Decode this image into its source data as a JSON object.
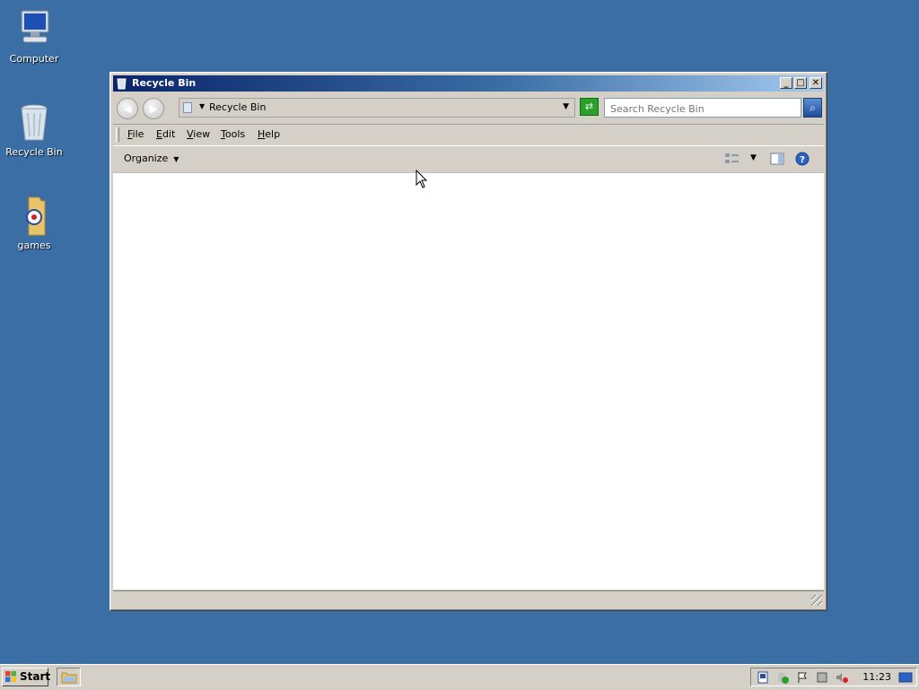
{
  "desktop": {
    "icons": [
      {
        "label": "Computer",
        "icon": "computer-icon"
      },
      {
        "label": "Recycle Bin",
        "icon": "recycle-bin-icon"
      },
      {
        "label": "games",
        "icon": "folder-icon"
      }
    ]
  },
  "window": {
    "title": "Recycle Bin",
    "address": "Recycle Bin",
    "search_placeholder": "Search Recycle Bin",
    "menu": [
      {
        "label": "File",
        "accel": "F",
        "rest": "ile"
      },
      {
        "label": "Edit",
        "accel": "E",
        "rest": "dit"
      },
      {
        "label": "View",
        "accel": "V",
        "rest": "iew"
      },
      {
        "label": "Tools",
        "accel": "T",
        "rest": "ools"
      },
      {
        "label": "Help",
        "accel": "H",
        "rest": "elp"
      }
    ],
    "organize_label": "Organize"
  },
  "taskbar": {
    "start_label": "Start",
    "clock": "11:23"
  },
  "colors": {
    "desktop": "#3a6ea5",
    "title_gradient_start": "#0a246a",
    "title_gradient_end": "#a6caf0"
  }
}
